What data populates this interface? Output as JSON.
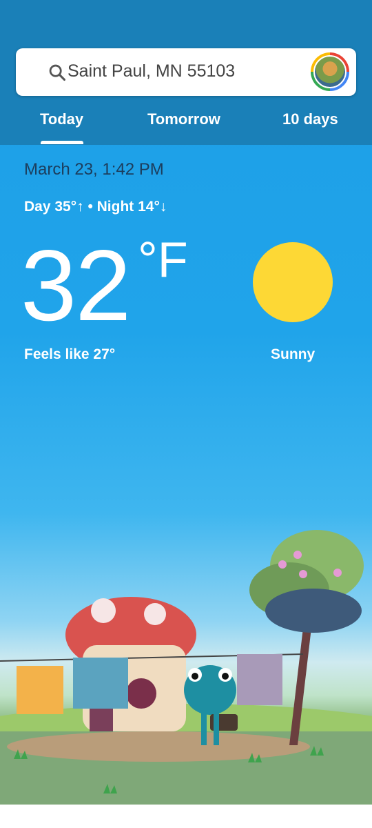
{
  "search": {
    "location": "Saint Paul, MN 55103"
  },
  "tabs": [
    {
      "label": "Today"
    },
    {
      "label": "Tomorrow"
    },
    {
      "label": "10 days"
    }
  ],
  "weather": {
    "date_time": "March 23, 1:42 PM",
    "day_night": "Day 35°↑ • Night 14°↓",
    "temperature": "32",
    "unit": "°F",
    "feels_like": "Feels like 27°",
    "condition": "Sunny"
  },
  "icons": {
    "search": "search-icon",
    "condition": "sun-icon",
    "avatar": "account-avatar"
  },
  "colors": {
    "header": "#1a80b8",
    "sky": "#20a4ea",
    "sun": "#fdd835"
  }
}
